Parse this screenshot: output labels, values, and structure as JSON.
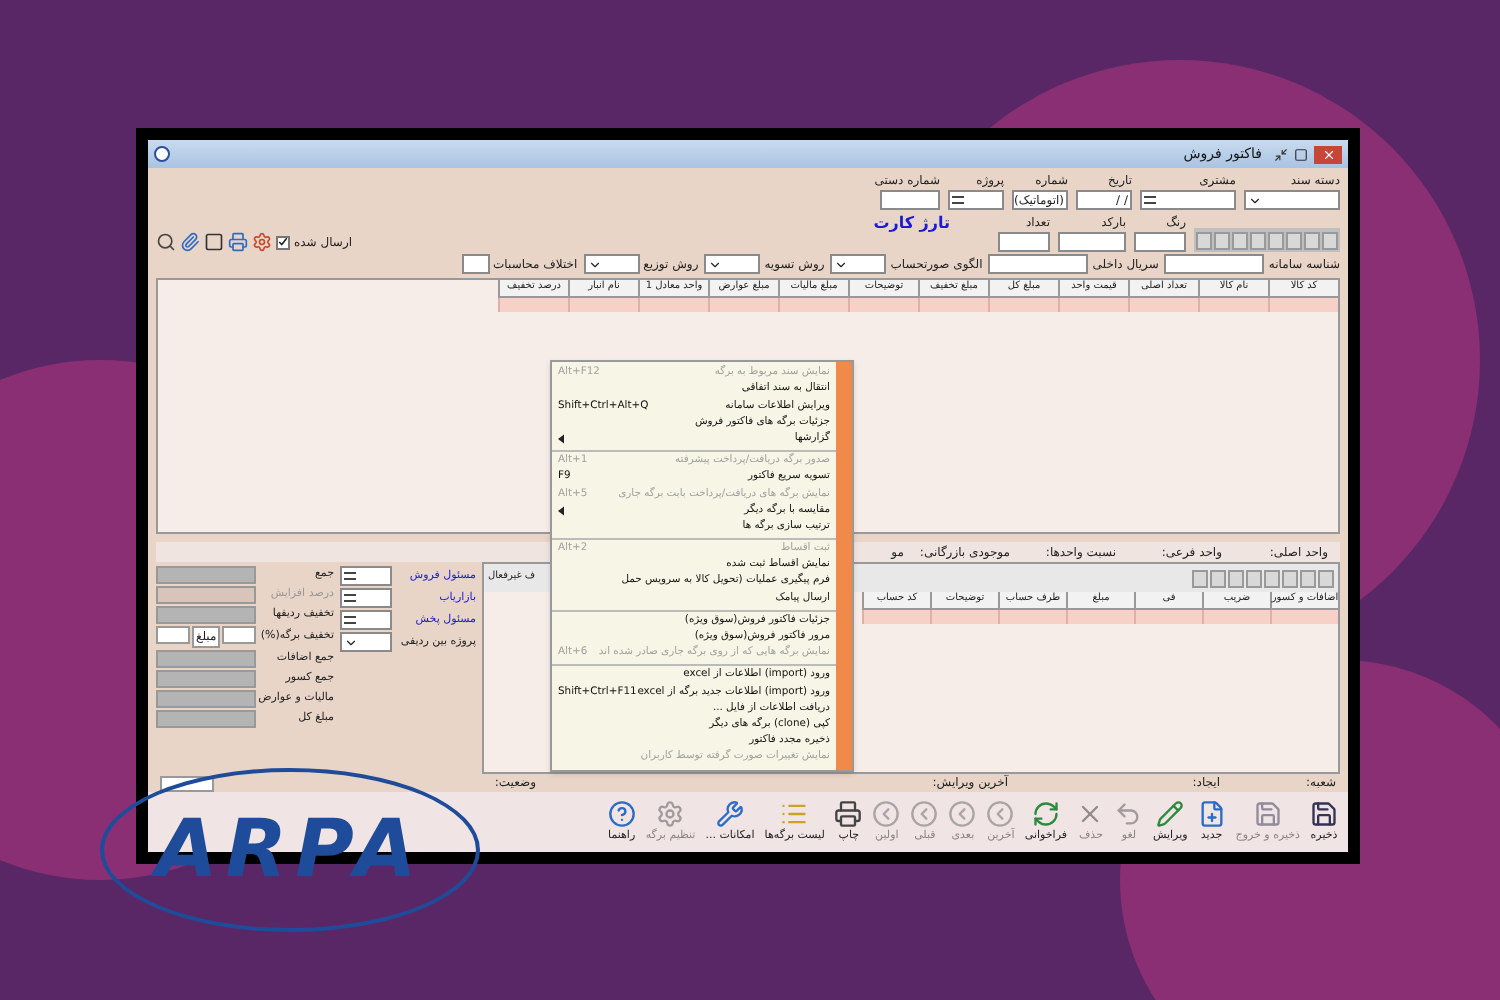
{
  "window": {
    "title": "فاکتور فروش"
  },
  "header_fields": [
    {
      "label": "دسته سند",
      "kind": "combo"
    },
    {
      "label": "مشتری",
      "kind": "lookup"
    },
    {
      "label": "تاریخ",
      "value": "/ /",
      "kind": "date"
    },
    {
      "label": "شماره",
      "value": "(اتوماتیک)",
      "kind": "combo"
    },
    {
      "label": "پروژه",
      "kind": "lookup"
    },
    {
      "label": "شماره دستی",
      "kind": "text"
    }
  ],
  "heading": "تارژ کارت",
  "item_fields": [
    {
      "label": "رنگ"
    },
    {
      "label": "بارکد"
    },
    {
      "label": "تعداد"
    }
  ],
  "sent": {
    "label": "ارسال شده",
    "checked": true
  },
  "options_row": [
    {
      "label": "شناسه سامانه",
      "kind": "text"
    },
    {
      "label": "سریال داخلی",
      "kind": "text"
    },
    {
      "label": "الگوی صورتحساب",
      "kind": "combo"
    },
    {
      "label": "روش تسویه",
      "kind": "combo"
    },
    {
      "label": "روش توزیع",
      "kind": "combo"
    },
    {
      "label": "اختلاف محاسبات",
      "kind": "text"
    }
  ],
  "table": {
    "columns": [
      "کد کالا",
      "نام کالا",
      "تعداد اصلی",
      "قیمت واحد",
      "مبلغ کل",
      "مبلغ تخفیف",
      "توضیحات",
      "مبلغ مالیات",
      "مبلغ عوارض",
      "واحد معادل 1",
      "نام انبار",
      "درصد تخفیف"
    ]
  },
  "context_menu": [
    [
      {
        "label": "نمایش سند مربوط به برگه",
        "shortcut": "Alt+F12",
        "disabled": true,
        "submenu": false
      },
      {
        "label": "انتقال به سند اتفاقی",
        "disabled": false,
        "submenu": false
      },
      {
        "label": "ویرایش اطلاعات سامانه",
        "shortcut": "Shift+Ctrl+Alt+Q",
        "disabled": false,
        "submenu": false
      },
      {
        "label": "جزئیات برگه های فاکتور فروش",
        "disabled": false,
        "submenu": false
      },
      {
        "label": "گزارشها",
        "disabled": false,
        "submenu": true
      }
    ],
    [
      {
        "label": "صدور برگه دریافت/پرداخت پیشرفته",
        "shortcut": "Alt+1",
        "disabled": true,
        "submenu": false
      },
      {
        "label": "تسویه سریع فاکتور",
        "shortcut": "F9",
        "disabled": false,
        "submenu": false
      },
      {
        "label": "نمایش برگه های دریافت/پرداخت بابت برگه جاری",
        "shortcut": "Alt+5",
        "disabled": true,
        "submenu": false
      },
      {
        "label": "مقایسه با برگه دیگر",
        "disabled": false,
        "submenu": true
      },
      {
        "label": "ترتیب سازی برگه ها",
        "disabled": false,
        "submenu": false
      }
    ],
    [
      {
        "label": "ثبت اقساط",
        "shortcut": "Alt+2",
        "disabled": true,
        "submenu": false
      },
      {
        "label": "نمایش اقساط ثبت شده",
        "disabled": false,
        "submenu": false
      },
      {
        "label": "فرم پیگیری عملیات (تحویل کالا به سرویس حمل",
        "disabled": false,
        "submenu": false
      },
      {
        "label": "ارسال پیامک",
        "disabled": false,
        "submenu": false
      }
    ],
    [
      {
        "label": "جزئیات فاکتور فروش(سوق ویژه)",
        "disabled": false,
        "submenu": false
      },
      {
        "label": "مرور فاکتور فروش(سوق ویژه)",
        "disabled": false,
        "submenu": false
      },
      {
        "label": "نمایش برگه هایی که از روی برگه جاری صادر شده اند",
        "shortcut": "Alt+6",
        "disabled": true,
        "submenu": false
      }
    ],
    [
      {
        "label": "ورود (import) اطلاعات از excel",
        "disabled": false,
        "submenu": false
      },
      {
        "label": "ورود (import) اطلاعات جدید برگه از excel",
        "shortcut": "Shift+Ctrl+F11",
        "disabled": false,
        "submenu": false
      },
      {
        "label": "دریافت اطلاعات از فایل ...",
        "disabled": false,
        "submenu": false
      },
      {
        "label": "کپی (clone) برگه های دیگر",
        "disabled": false,
        "submenu": false
      },
      {
        "label": "ذخیره مجدد فاکتور",
        "disabled": false,
        "submenu": false
      },
      {
        "label": "نمایش تغییرات صورت گرفته توسط کاربران",
        "disabled": true,
        "submenu": false
      }
    ]
  ],
  "unit_info": [
    "واحد اصلی:",
    "واحد فرعی:",
    "نسبت واحدها:",
    "موجودی بازرگانی:",
    "مو"
  ],
  "people": [
    {
      "label": "مسئول فروش"
    },
    {
      "label": "بازاریاب"
    },
    {
      "label": "مسئول پخش"
    },
    {
      "label": "پروژه بین ردیفی"
    }
  ],
  "totals": [
    {
      "label": "جمع",
      "disabled": false
    },
    {
      "label": "درصد افزایش",
      "disabled": true
    },
    {
      "label": "تخفیف ردیفها",
      "disabled": false
    },
    {
      "label": "تخفیف برگه(%)",
      "disabled": false,
      "amount_label": "مبلغ"
    },
    {
      "label": "جمع اضافات",
      "disabled": false
    },
    {
      "label": "جمع کسور",
      "disabled": false
    },
    {
      "label": "مالیات و عوارض",
      "disabled": false
    },
    {
      "label": "مبلغ کل",
      "disabled": false
    }
  ],
  "inactive_row_label": "ف غیرفعال",
  "lower_table": {
    "columns": [
      "اضافات و کسور",
      "ضریب",
      "فی",
      "مبلغ",
      "طرف حساب",
      "توضیحات",
      "کد حساب"
    ]
  },
  "status_bar": [
    "شعبه:",
    "ایجاد:",
    "آخرین ویرایش:",
    "وضعیت:"
  ],
  "toolbar": [
    {
      "label": "ذخیره",
      "kind": "save",
      "disabled": false
    },
    {
      "label": "ذخیره و خروج",
      "kind": "save",
      "disabled": true
    },
    {
      "label": "جدید",
      "kind": "new",
      "disabled": false
    },
    {
      "label": "ویرایش",
      "kind": "edit",
      "disabled": false
    },
    {
      "label": "لغو",
      "kind": "undo",
      "disabled": true
    },
    {
      "label": "حذف",
      "kind": "delete",
      "disabled": true
    },
    {
      "label": "فراخوانی",
      "kind": "refresh",
      "disabled": false
    },
    {
      "label": "آخرین",
      "kind": "nav",
      "disabled": true
    },
    {
      "label": "بعدی",
      "kind": "nav",
      "disabled": true
    },
    {
      "label": "قبلی",
      "kind": "nav",
      "disabled": true
    },
    {
      "label": "اولین",
      "kind": "nav",
      "disabled": true
    },
    {
      "label": "چاپ",
      "kind": "print",
      "disabled": false
    },
    {
      "label": "لیست برگه‌ها",
      "kind": "list",
      "disabled": false
    },
    {
      "label": "امکانات ...",
      "kind": "tools",
      "disabled": false
    },
    {
      "label": "تنظیم برگه",
      "kind": "settings",
      "disabled": true
    },
    {
      "label": "راهنما",
      "kind": "help",
      "disabled": false
    }
  ],
  "logo": "ARPA"
}
